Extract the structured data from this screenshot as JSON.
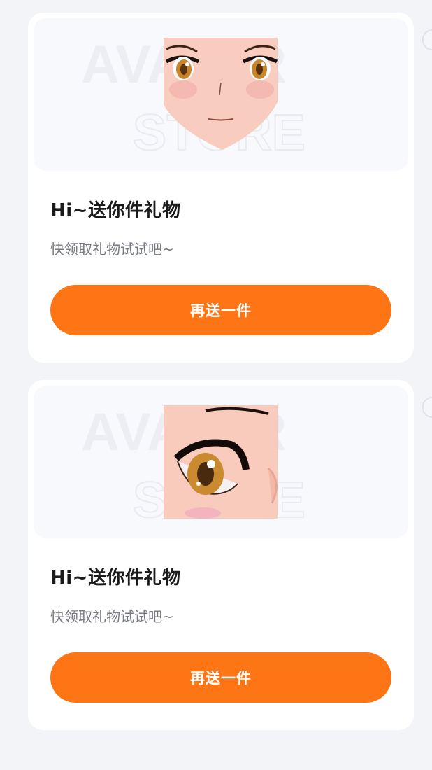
{
  "gifts": [
    {
      "preview_icon": "anime-face-icon",
      "watermark_line1": "AVATAR",
      "watermark_line2": "STORE",
      "title": "Hi~送你件礼物",
      "subtitle": "快领取礼物试试吧~",
      "button_label": "再送一件"
    },
    {
      "preview_icon": "anime-eye-icon",
      "watermark_line1": "AVATAR",
      "watermark_line2": "STORE",
      "title": "Hi~送你件礼物",
      "subtitle": "快领取礼物试试吧~",
      "button_label": "再送一件"
    }
  ],
  "colors": {
    "accent": "#fd7515",
    "background": "#f2f4f8",
    "card": "#ffffff",
    "title": "#1b1b1b",
    "subtitle": "#777a80"
  }
}
